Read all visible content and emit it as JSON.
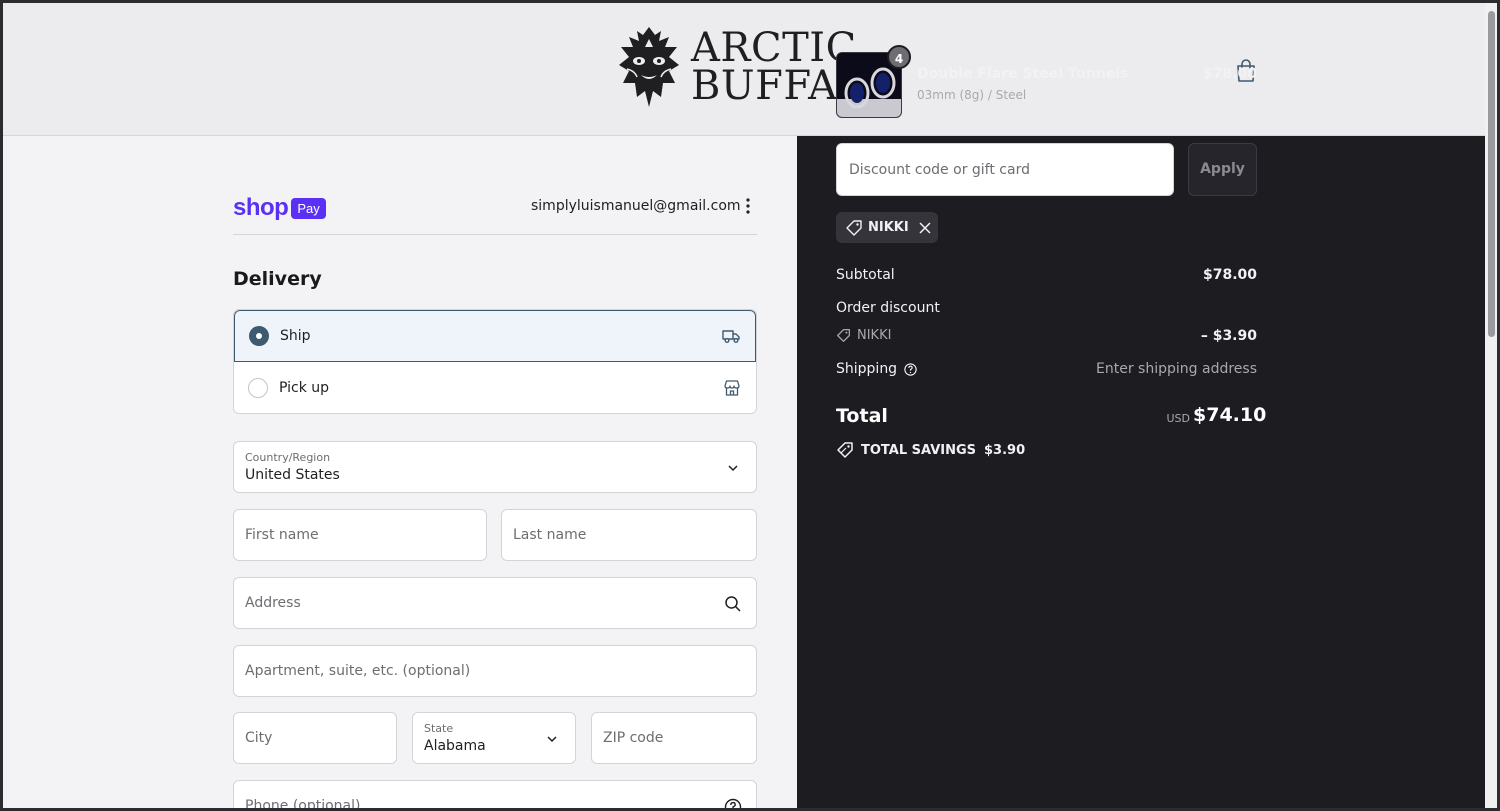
{
  "brand": {
    "line1": "ARCTIC",
    "line2": "BUFFALO"
  },
  "account": {
    "shop_label": "shop",
    "pay_label": "Pay",
    "email": "simplyluismanuel@gmail.com"
  },
  "delivery": {
    "title": "Delivery",
    "options": [
      {
        "label": "Ship",
        "selected": true,
        "icon": "truck-icon"
      },
      {
        "label": "Pick up",
        "selected": false,
        "icon": "store-icon"
      }
    ]
  },
  "form": {
    "country_label": "Country/Region",
    "country_value": "United States",
    "first_name_placeholder": "First name",
    "last_name_placeholder": "Last name",
    "address_placeholder": "Address",
    "apartment_placeholder": "Apartment, suite, etc. (optional)",
    "city_placeholder": "City",
    "state_label": "State",
    "state_value": "Alabama",
    "zip_placeholder": "ZIP code",
    "phone_placeholder": "Phone (optional)"
  },
  "cart": {
    "item": {
      "name": "Double Flare Steel Tunnels",
      "variant": "03mm (8g) / Steel",
      "price": "$78.00",
      "quantity": "4"
    },
    "discount_placeholder": "Discount code or gift card",
    "apply_label": "Apply",
    "applied_code": "NIKKI",
    "subtotal_label": "Subtotal",
    "subtotal_value": "$78.00",
    "order_discount_label": "Order discount",
    "discount_code": "NIKKI",
    "discount_value": "– $3.90",
    "shipping_label": "Shipping",
    "shipping_value": "Enter shipping address",
    "total_label": "Total",
    "total_currency": "USD",
    "total_value": "$74.10",
    "savings_label": "TOTAL SAVINGS",
    "savings_value": "$3.90"
  },
  "colors": {
    "shop_pay": "#5a31f4",
    "summary_bg": "#1d1c21",
    "accent": "#3e5a70"
  }
}
